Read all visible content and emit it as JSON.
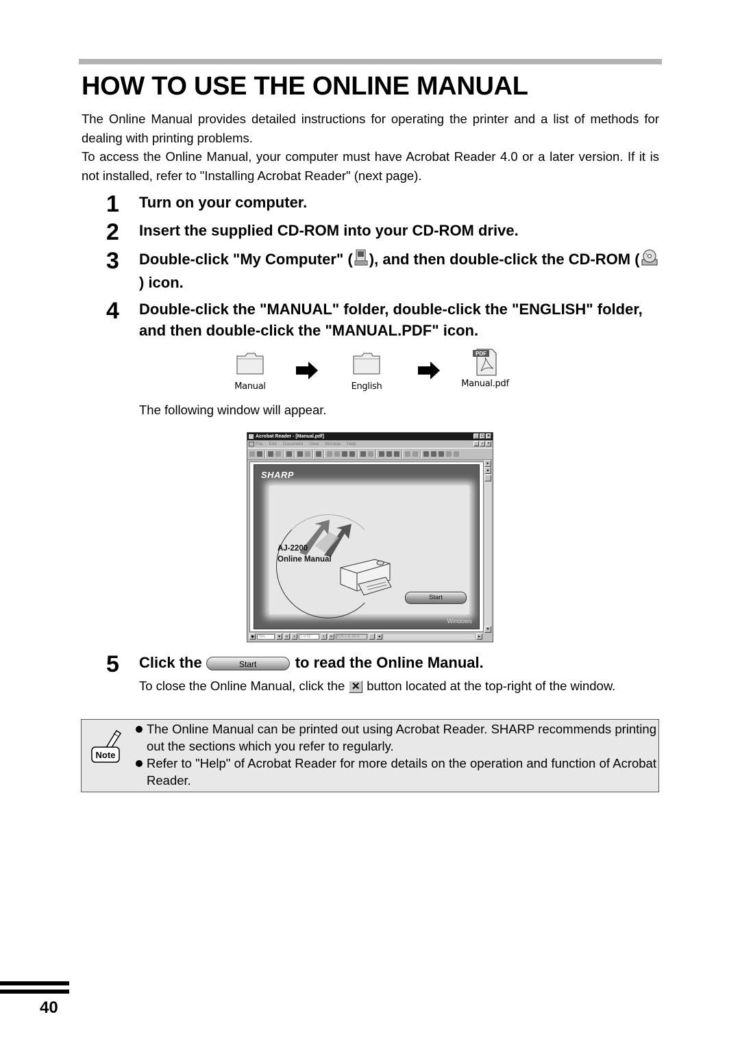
{
  "page": {
    "title": "HOW TO USE THE ONLINE MANUAL",
    "intro": [
      "The Online Manual provides detailed instructions for operating the printer and a list of methods for dealing with printing problems.",
      "To access the Online Manual, your computer must have Acrobat Reader 4.0 or a later version. If it is not installed, refer to \"Installing Acrobat Reader\" (next page)."
    ],
    "page_number": "40"
  },
  "steps": [
    {
      "num": "1",
      "text": "Turn on your computer."
    },
    {
      "num": "2",
      "text": "Insert the supplied CD-ROM into your CD-ROM drive."
    },
    {
      "num": "3",
      "text_a": "Double-click \"My Computer\" (",
      "text_b": "), and then double-click the CD-ROM (",
      "text_c": ") icon.",
      "icons": [
        "my-computer-icon",
        "cd-rom-icon"
      ]
    },
    {
      "num": "4",
      "text": "Double-click the \"MANUAL\" folder, double-click the \"ENGLISH\" folder, and then double-click the \"MANUAL.PDF\" icon."
    },
    {
      "num": "5",
      "text_a": "Click the",
      "button_label": "Start",
      "text_b": "to read the Online Manual."
    }
  ],
  "flow": {
    "items": [
      {
        "label": "Manual",
        "icon": "folder-icon"
      },
      {
        "label": "English",
        "icon": "folder-icon"
      },
      {
        "label": "Manual.pdf",
        "icon": "pdf-file-icon"
      }
    ],
    "pdf_badge": "PDF",
    "caption": "The following window will appear."
  },
  "acrobat_window": {
    "title": "Acrobat Reader - [Manual.pdf]",
    "menu": [
      "File",
      "Edit",
      "Document",
      "View",
      "Window",
      "Help"
    ],
    "brand": "SHARP",
    "model": "AJ-2200",
    "subtitle": "Online Manual",
    "start_label": "Start",
    "platform": "Windows",
    "status": {
      "zoom": "75%",
      "page": "1 of 52",
      "size": "8.26 x 11.69 in"
    }
  },
  "step5_detail": {
    "text_a": "To close the Online Manual, click the",
    "close_glyph": "✕",
    "text_b": "button located at the top-right of the window."
  },
  "note": {
    "label": "Note",
    "items": [
      "The Online Manual can be printed out using Acrobat Reader. SHARP recommends printing out the sections which you refer to regularly.",
      "Refer to \"Help\" of Acrobat Reader for more details on the operation and function of Acrobat Reader."
    ]
  }
}
